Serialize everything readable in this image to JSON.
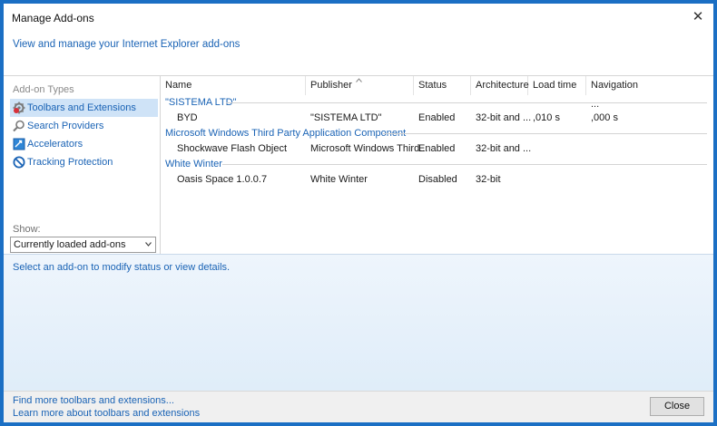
{
  "window": {
    "title": "Manage Add-ons",
    "close_glyph": "✕"
  },
  "subtitle": "View and manage your Internet Explorer add-ons",
  "sidebar": {
    "title": "Add-on Types",
    "items": [
      {
        "label": "Toolbars and Extensions",
        "icon": "gear-icon"
      },
      {
        "label": "Search Providers",
        "icon": "search-icon"
      },
      {
        "label": "Accelerators",
        "icon": "accelerator-icon"
      },
      {
        "label": "Tracking Protection",
        "icon": "no-entry-icon"
      }
    ],
    "show_label": "Show:",
    "show_value": "Currently loaded add-ons"
  },
  "columns": [
    "Name",
    "Publisher",
    "Status",
    "Architecture",
    "Load time",
    "Navigation ..."
  ],
  "groups": [
    {
      "name": "\"SISTEMA LTD\"",
      "rows": [
        [
          "BYD",
          "\"SISTEMA LTD\"",
          "Enabled",
          "32-bit and ...",
          ",010 s",
          ",000 s"
        ]
      ]
    },
    {
      "name": "Microsoft Windows Third Party Application Component",
      "rows": [
        [
          "Shockwave Flash Object",
          "Microsoft Windows Third...",
          "Enabled",
          "32-bit and ...",
          "",
          ""
        ]
      ]
    },
    {
      "name": "White Winter",
      "rows": [
        [
          "Oasis Space 1.0.0.7",
          "White Winter",
          "Disabled",
          "32-bit",
          "",
          ""
        ]
      ]
    }
  ],
  "status_text": "Select an add-on to modify status or view details.",
  "footer": {
    "link1": "Find more toolbars and extensions...",
    "link2": "Learn more about toolbars and extensions",
    "close_label": "Close"
  },
  "colors": {
    "frame": "#1b6fc4",
    "link": "#1a63b5",
    "selection": "#cfe3f7"
  }
}
